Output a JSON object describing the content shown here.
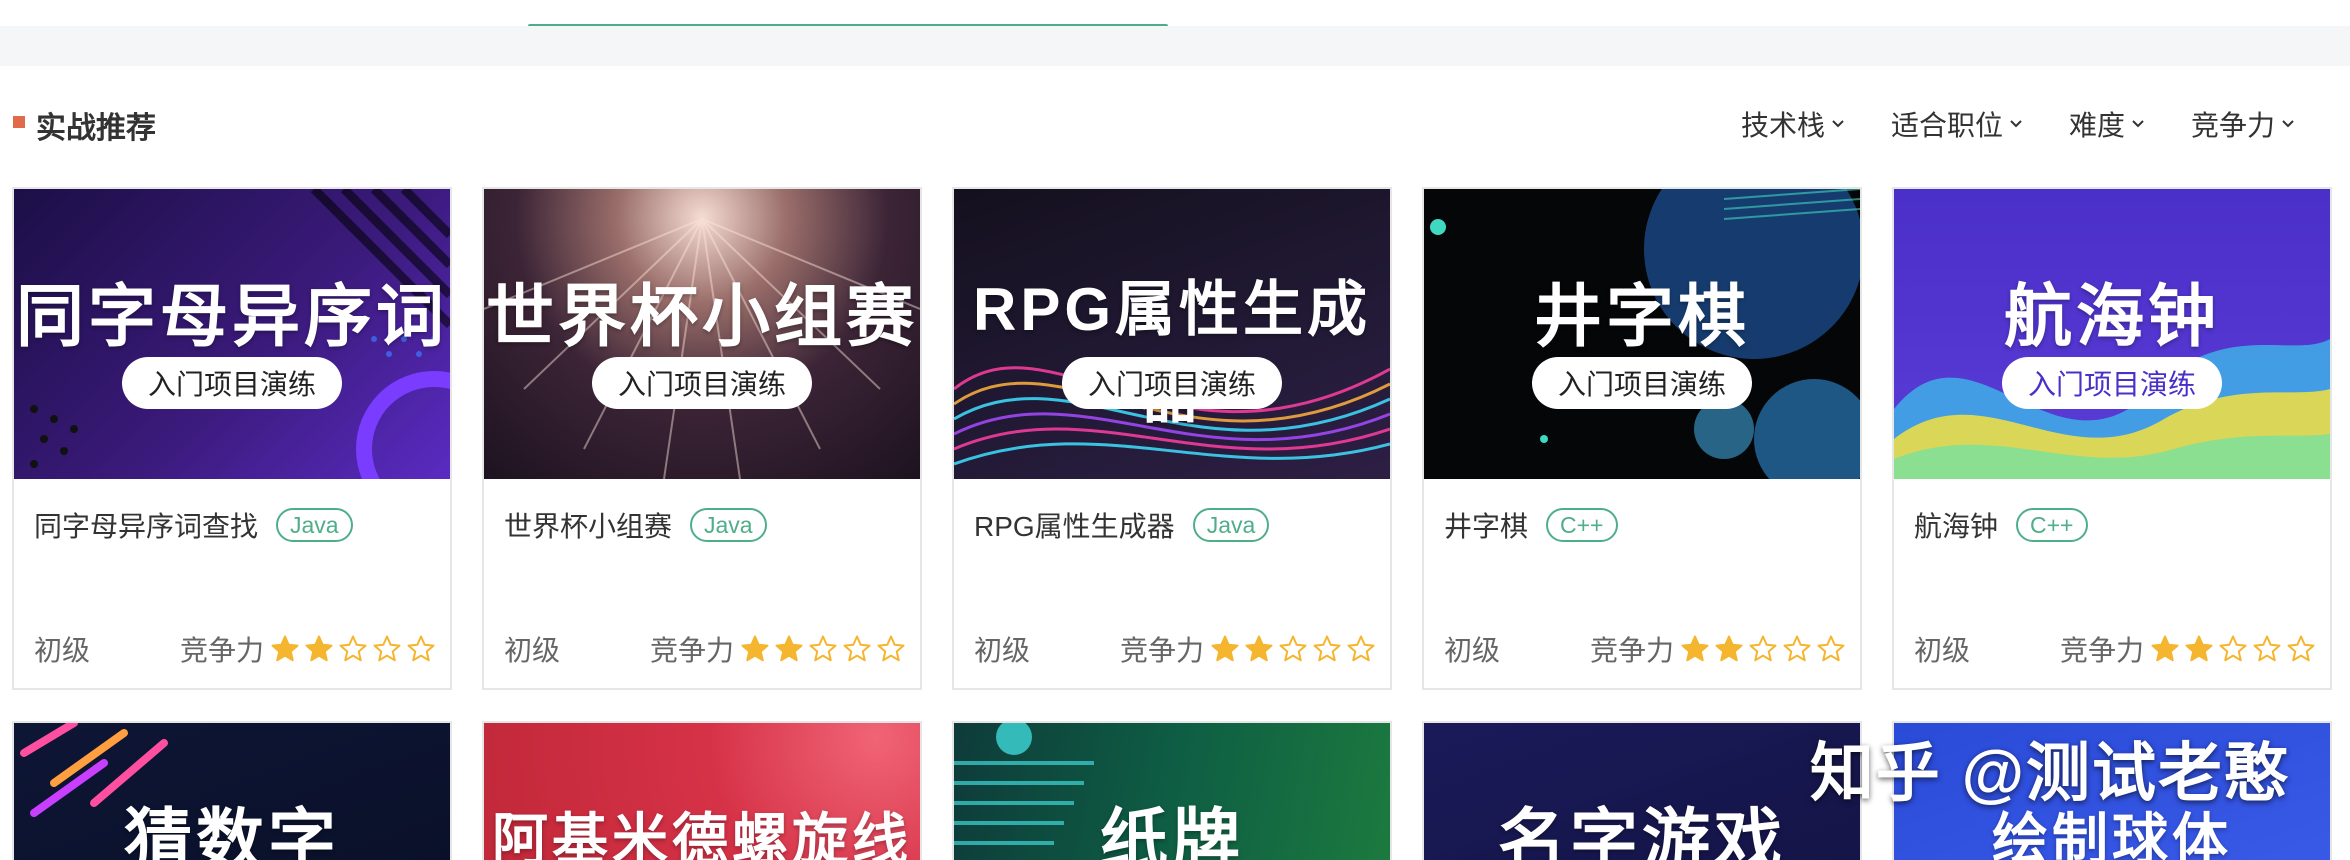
{
  "section": {
    "title": "实战推荐"
  },
  "filters": [
    {
      "label": "技术栈"
    },
    {
      "label": "适合职位"
    },
    {
      "label": "难度"
    },
    {
      "label": "竞争力"
    }
  ],
  "cards": [
    {
      "banner": "同字母异序词",
      "pill": "入门项目演练",
      "name": "同字母异序词查找",
      "lang": "Java",
      "level": "初级",
      "compete_label": "竞争力",
      "rating": 2,
      "rating_max": 5
    },
    {
      "banner": "世界杯小组赛",
      "pill": "入门项目演练",
      "name": "世界杯小组赛",
      "lang": "Java",
      "level": "初级",
      "compete_label": "竞争力",
      "rating": 2,
      "rating_max": 5
    },
    {
      "banner": "RPG属性生成器",
      "pill": "入门项目演练",
      "name": "RPG属性生成器",
      "lang": "Java",
      "level": "初级",
      "compete_label": "竞争力",
      "rating": 2,
      "rating_max": 5
    },
    {
      "banner": "井字棋",
      "pill": "入门项目演练",
      "name": "井字棋",
      "lang": "C++",
      "level": "初级",
      "compete_label": "竞争力",
      "rating": 2,
      "rating_max": 5
    },
    {
      "banner": "航海钟",
      "pill": "入门项目演练",
      "name": "航海钟",
      "lang": "C++",
      "level": "初级",
      "compete_label": "竞争力",
      "rating": 2,
      "rating_max": 5
    }
  ],
  "cards_row2": [
    {
      "banner": "猜数字"
    },
    {
      "banner": "阿基米德螺旋线"
    },
    {
      "banner": "纸牌"
    },
    {
      "banner": "名字游戏"
    },
    {
      "banner": "绘制球体"
    }
  ],
  "watermark": "知乎 @测试老憨",
  "colors": {
    "accent": "#4fae8a",
    "marker": "#e06a4a",
    "star": "#f5b52e"
  }
}
